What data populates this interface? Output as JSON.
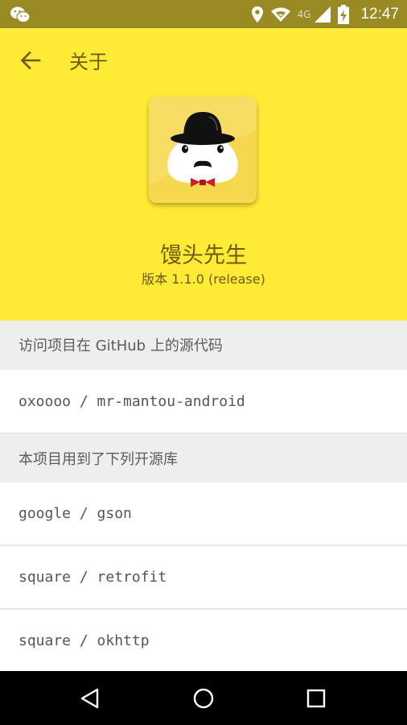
{
  "status_bar": {
    "time": "12:47",
    "network": "4G",
    "icons": [
      "wechat-icon",
      "location-icon",
      "wifi-icon",
      "signal-icon",
      "battery-charging-icon"
    ]
  },
  "toolbar": {
    "title": "关于",
    "back_icon": "arrow-back-icon"
  },
  "app": {
    "name": "馒头先生",
    "version": "版本 1.1.0 (release)"
  },
  "sections": {
    "source": {
      "header": "访问项目在 GitHub 上的源代码",
      "items": [
        "oxoooo / mr-mantou-android"
      ]
    },
    "libraries": {
      "header": "本项目用到了下列开源库",
      "items": [
        "google / gson",
        "square / retrofit",
        "square / okhttp"
      ]
    }
  },
  "nav_bar": {
    "icons": [
      "back-triangle-icon",
      "home-circle-icon",
      "recents-square-icon"
    ]
  },
  "colors": {
    "header": "#ffea35",
    "status_bar": "#9a8a23",
    "text_brown": "#6e5a12",
    "section_bg": "#eeeeee"
  }
}
